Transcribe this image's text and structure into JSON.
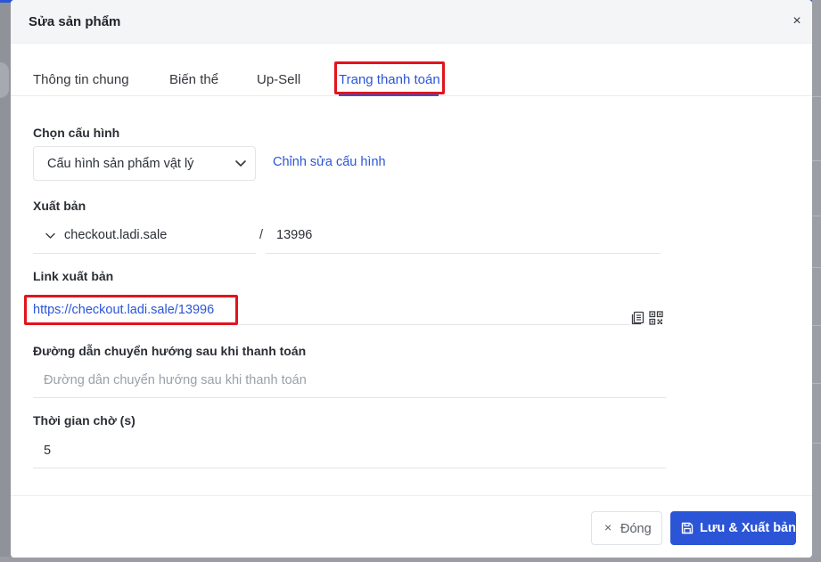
{
  "modal": {
    "title": "Sửa sản phẩm",
    "close_glyph": "×"
  },
  "tabs": [
    {
      "label": "Thông tin chung",
      "active": false
    },
    {
      "label": "Biến thể",
      "active": false
    },
    {
      "label": "Up-Sell",
      "active": false
    },
    {
      "label": "Trang thanh toán",
      "active": true
    }
  ],
  "config": {
    "label": "Chọn cấu hình",
    "selected": "Cấu hình sản phẩm vật lý",
    "edit_link": "Chỉnh sửa cấu hình"
  },
  "publish": {
    "label": "Xuất bản",
    "domain": "checkout.ladi.sale",
    "separator": "/",
    "path": "13996"
  },
  "link": {
    "label": "Link xuất bản",
    "url": "https://checkout.ladi.sale/13996"
  },
  "redirect": {
    "label": "Đường dẫn chuyển hướng sau khi thanh toán",
    "placeholder": "Đường dẫn chuyển hướng sau khi thanh toán",
    "value": ""
  },
  "wait_time": {
    "label": "Thời gian chờ (s)",
    "value": "5"
  },
  "footer": {
    "close_label": "Đóng",
    "close_glyph": "×",
    "save_label": "Lưu & Xuất bản"
  },
  "colors": {
    "accent": "#2b55d6",
    "highlight": "#e2141c",
    "overlay": "#8f9298"
  },
  "icons": {
    "close": "close-icon",
    "chevron": "chevron-down-icon",
    "copy": "copy-icon",
    "qr": "qr-code-icon",
    "save": "save-icon"
  }
}
